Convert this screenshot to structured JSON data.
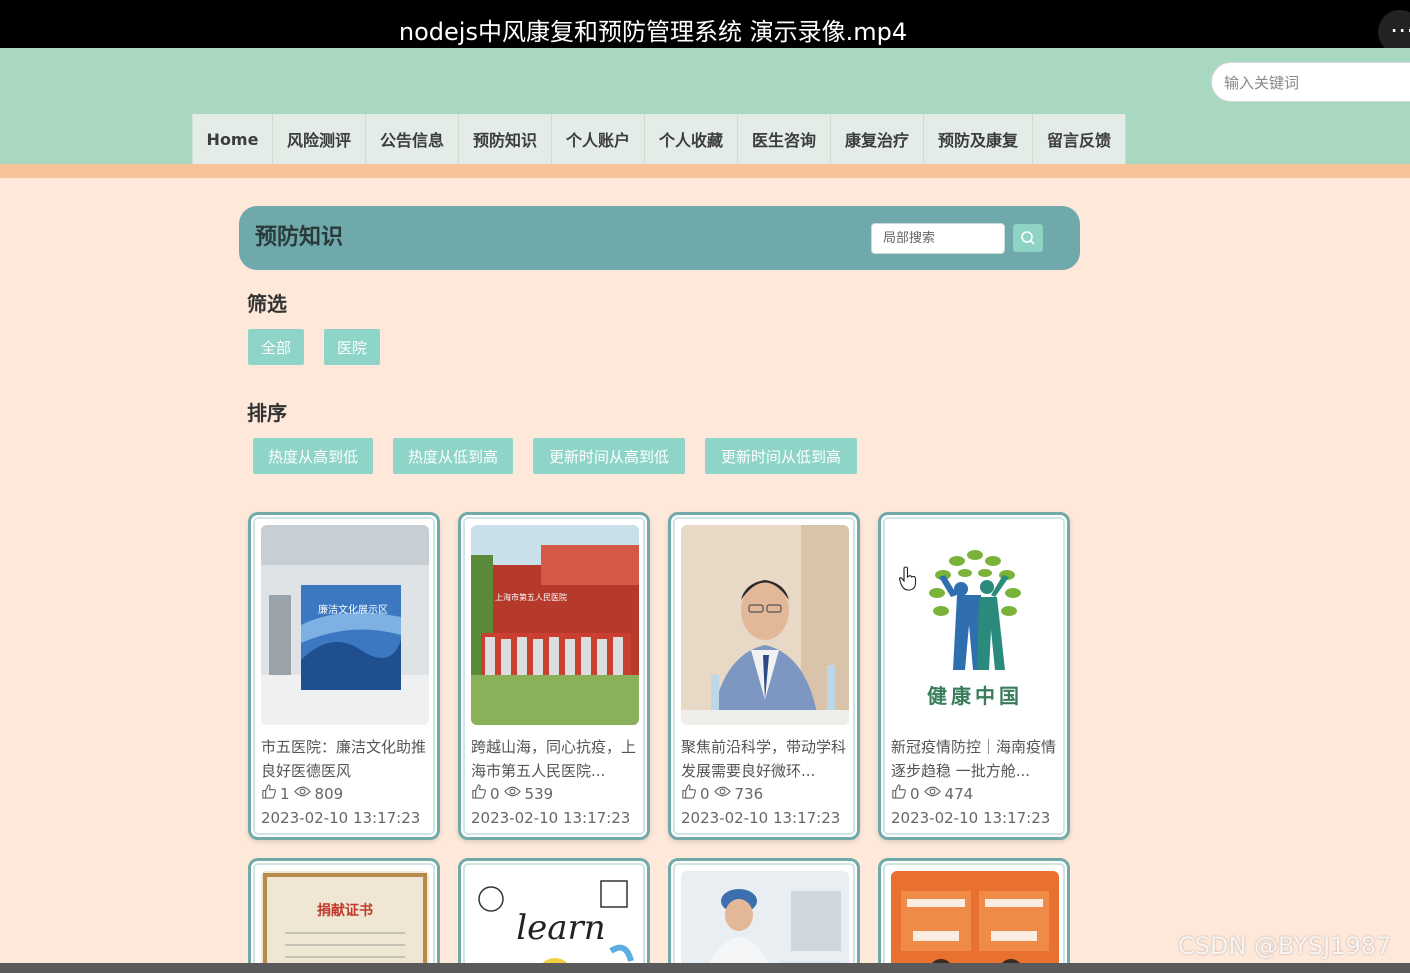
{
  "video": {
    "title": "nodejs中风康复和预防管理系统 演示录像.mp4",
    "menu_glyph": "⋯"
  },
  "header": {
    "search_placeholder": "输入关键词",
    "nav": [
      "Home",
      "风险测评",
      "公告信息",
      "预防知识",
      "个人账户",
      "个人收藏",
      "医生咨询",
      "康复治疗",
      "预防及康复",
      "留言反馈"
    ]
  },
  "section": {
    "title": "预防知识",
    "search_placeholder": "局部搜索"
  },
  "filter": {
    "label": "筛选",
    "options": [
      "全部",
      "医院"
    ]
  },
  "sort": {
    "label": "排序",
    "options": [
      "热度从高到低",
      "热度从低到高",
      "更新时间从高到低",
      "更新时间从低到高"
    ]
  },
  "cards": [
    {
      "title": "市五医院：廉洁文化助推良好医德医风",
      "likes": "1",
      "views": "809",
      "date": "2023-02-10 13:17:23"
    },
    {
      "title": "跨越山海，同心抗疫，上海市第五人民医院...",
      "likes": "0",
      "views": "539",
      "date": "2023-02-10 13:17:23"
    },
    {
      "title": "聚焦前沿科学，带动学科发展需要良好微环...",
      "likes": "0",
      "views": "736",
      "date": "2023-02-10 13:17:23"
    },
    {
      "title": "新冠疫情防控｜海南疫情逐步趋稳 一批方舱...",
      "likes": "0",
      "views": "474",
      "date": "2023-02-10 13:17:23"
    }
  ],
  "card_images": {
    "img1_text": "廉洁文化展示区",
    "img2_text": "上海市第五人民医院",
    "img4_logo": "健康中国",
    "img5_text": "捐献证书",
    "img6_text": "learn"
  },
  "watermark": "CSDN @BYSJ1987",
  "colors": {
    "header": "#a8d8c0",
    "accent": "#f7c398",
    "page_bg": "#fde8d9",
    "section_bar": "#6fa9ab",
    "chip": "#8ed4c8",
    "card_border": "#71aaa9"
  }
}
